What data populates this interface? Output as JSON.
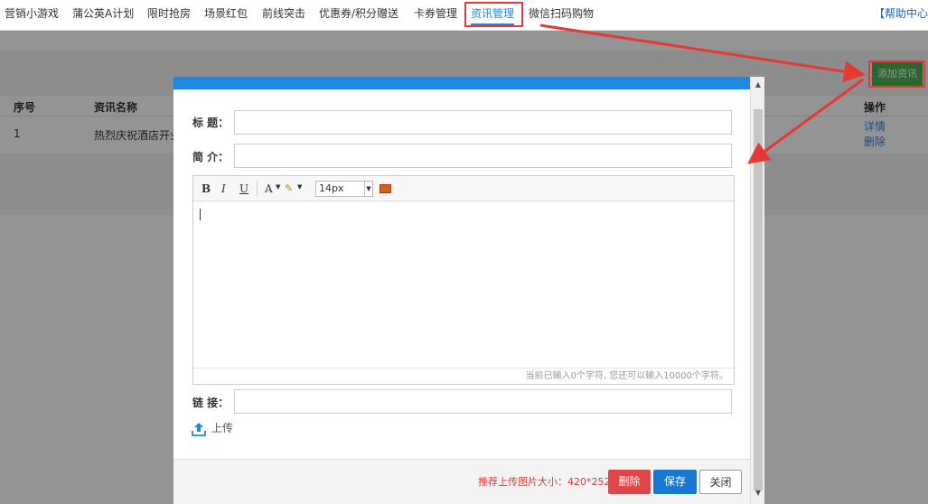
{
  "topnav": {
    "items": [
      "营销小游戏",
      "蒲公英A计划",
      "限时抢房",
      "场景红包",
      "前线突击",
      "优惠券/积分赠送",
      "卡券管理",
      "资讯管理",
      "微信扫码购物"
    ],
    "active_index": 7,
    "help": "【帮助中心"
  },
  "page": {
    "add_button": "添加资讯",
    "columns": {
      "index": "序号",
      "name": "资讯名称",
      "actions": "操作"
    },
    "rows": [
      {
        "index": "1",
        "name": "热烈庆祝酒店开业",
        "detail": "详情",
        "delete": "删除"
      }
    ]
  },
  "modal": {
    "title_label": "标   题：",
    "intro_label": "简   介：",
    "link_label": "链   接：",
    "editor": {
      "bold": "B",
      "italic": "I",
      "underline": "U",
      "font_color": "A",
      "font_size": "14px",
      "counter": "当前已输入0个字符, 您还可以输入10000个字符。"
    },
    "upload_label": "上传",
    "footer": {
      "hint": "推荐上传图片大小：420*252",
      "delete": "删除",
      "save": "保存",
      "close": "关闭"
    }
  },
  "colors": {
    "accent": "#1e88e5",
    "highlight": "#e53935",
    "add_button": "#4caf50",
    "delete_button": "#e04646",
    "save_button": "#1976d2"
  }
}
